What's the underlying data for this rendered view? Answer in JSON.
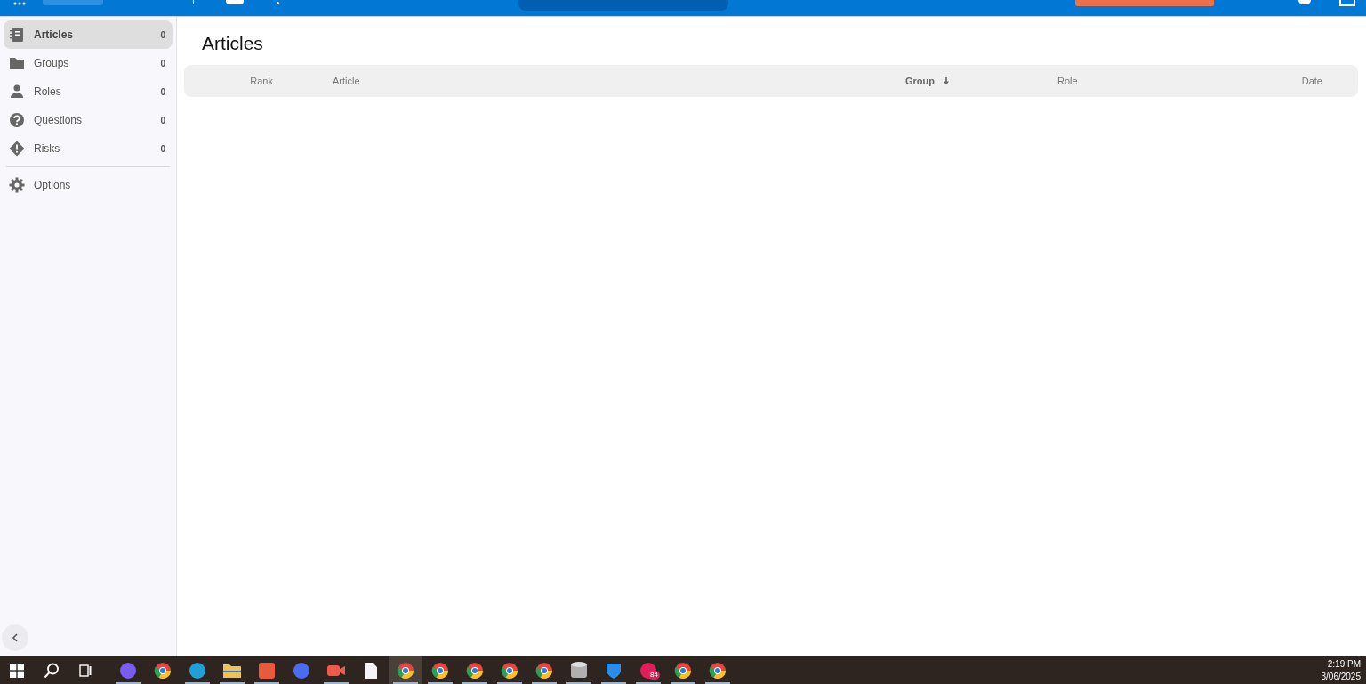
{
  "sidebar": {
    "items": [
      {
        "kind": "articles",
        "label": "Articles",
        "count": "0",
        "selected": true
      },
      {
        "kind": "groups",
        "label": "Groups",
        "count": "0",
        "selected": false
      },
      {
        "kind": "roles",
        "label": "Roles",
        "count": "0",
        "selected": false
      },
      {
        "kind": "questions",
        "label": "Questions",
        "count": "0",
        "selected": false
      },
      {
        "kind": "risks",
        "label": "Risks",
        "count": "0",
        "selected": false
      }
    ],
    "footer_items": [
      {
        "kind": "options",
        "label": "Options"
      }
    ]
  },
  "page": {
    "title": "Articles"
  },
  "table": {
    "columns": [
      {
        "label": "Rank",
        "sorted": false
      },
      {
        "label": "Article",
        "sorted": false
      },
      {
        "label": "Group",
        "sorted": true
      },
      {
        "label": "Role",
        "sorted": false
      },
      {
        "label": "Date",
        "sorted": false
      }
    ]
  },
  "taskbar": {
    "apps": [
      {
        "kind": "copilot",
        "running": true,
        "selected": false
      },
      {
        "kind": "browser",
        "running": false,
        "selected": false
      },
      {
        "kind": "edge",
        "running": true,
        "selected": false
      },
      {
        "kind": "folder",
        "running": true,
        "selected": false
      },
      {
        "kind": "store",
        "running": true,
        "selected": false
      },
      {
        "kind": "hex",
        "running": false,
        "selected": false
      },
      {
        "kind": "camera",
        "running": true,
        "selected": false
      },
      {
        "kind": "document",
        "running": false,
        "selected": false
      },
      {
        "kind": "browser",
        "running": true,
        "selected": true
      },
      {
        "kind": "browser",
        "running": true,
        "selected": false
      },
      {
        "kind": "browser",
        "running": true,
        "selected": false
      },
      {
        "kind": "browser",
        "running": true,
        "selected": false
      },
      {
        "kind": "browser",
        "running": true,
        "selected": false
      },
      {
        "kind": "database",
        "running": true,
        "selected": false
      },
      {
        "kind": "shield",
        "running": true,
        "selected": false
      },
      {
        "kind": "chat",
        "running": true,
        "selected": false,
        "badge": "84"
      },
      {
        "kind": "browser",
        "running": true,
        "selected": false
      },
      {
        "kind": "browser",
        "running": true,
        "selected": false
      }
    ],
    "time": "2:19 PM",
    "date": "3/06/2025"
  }
}
